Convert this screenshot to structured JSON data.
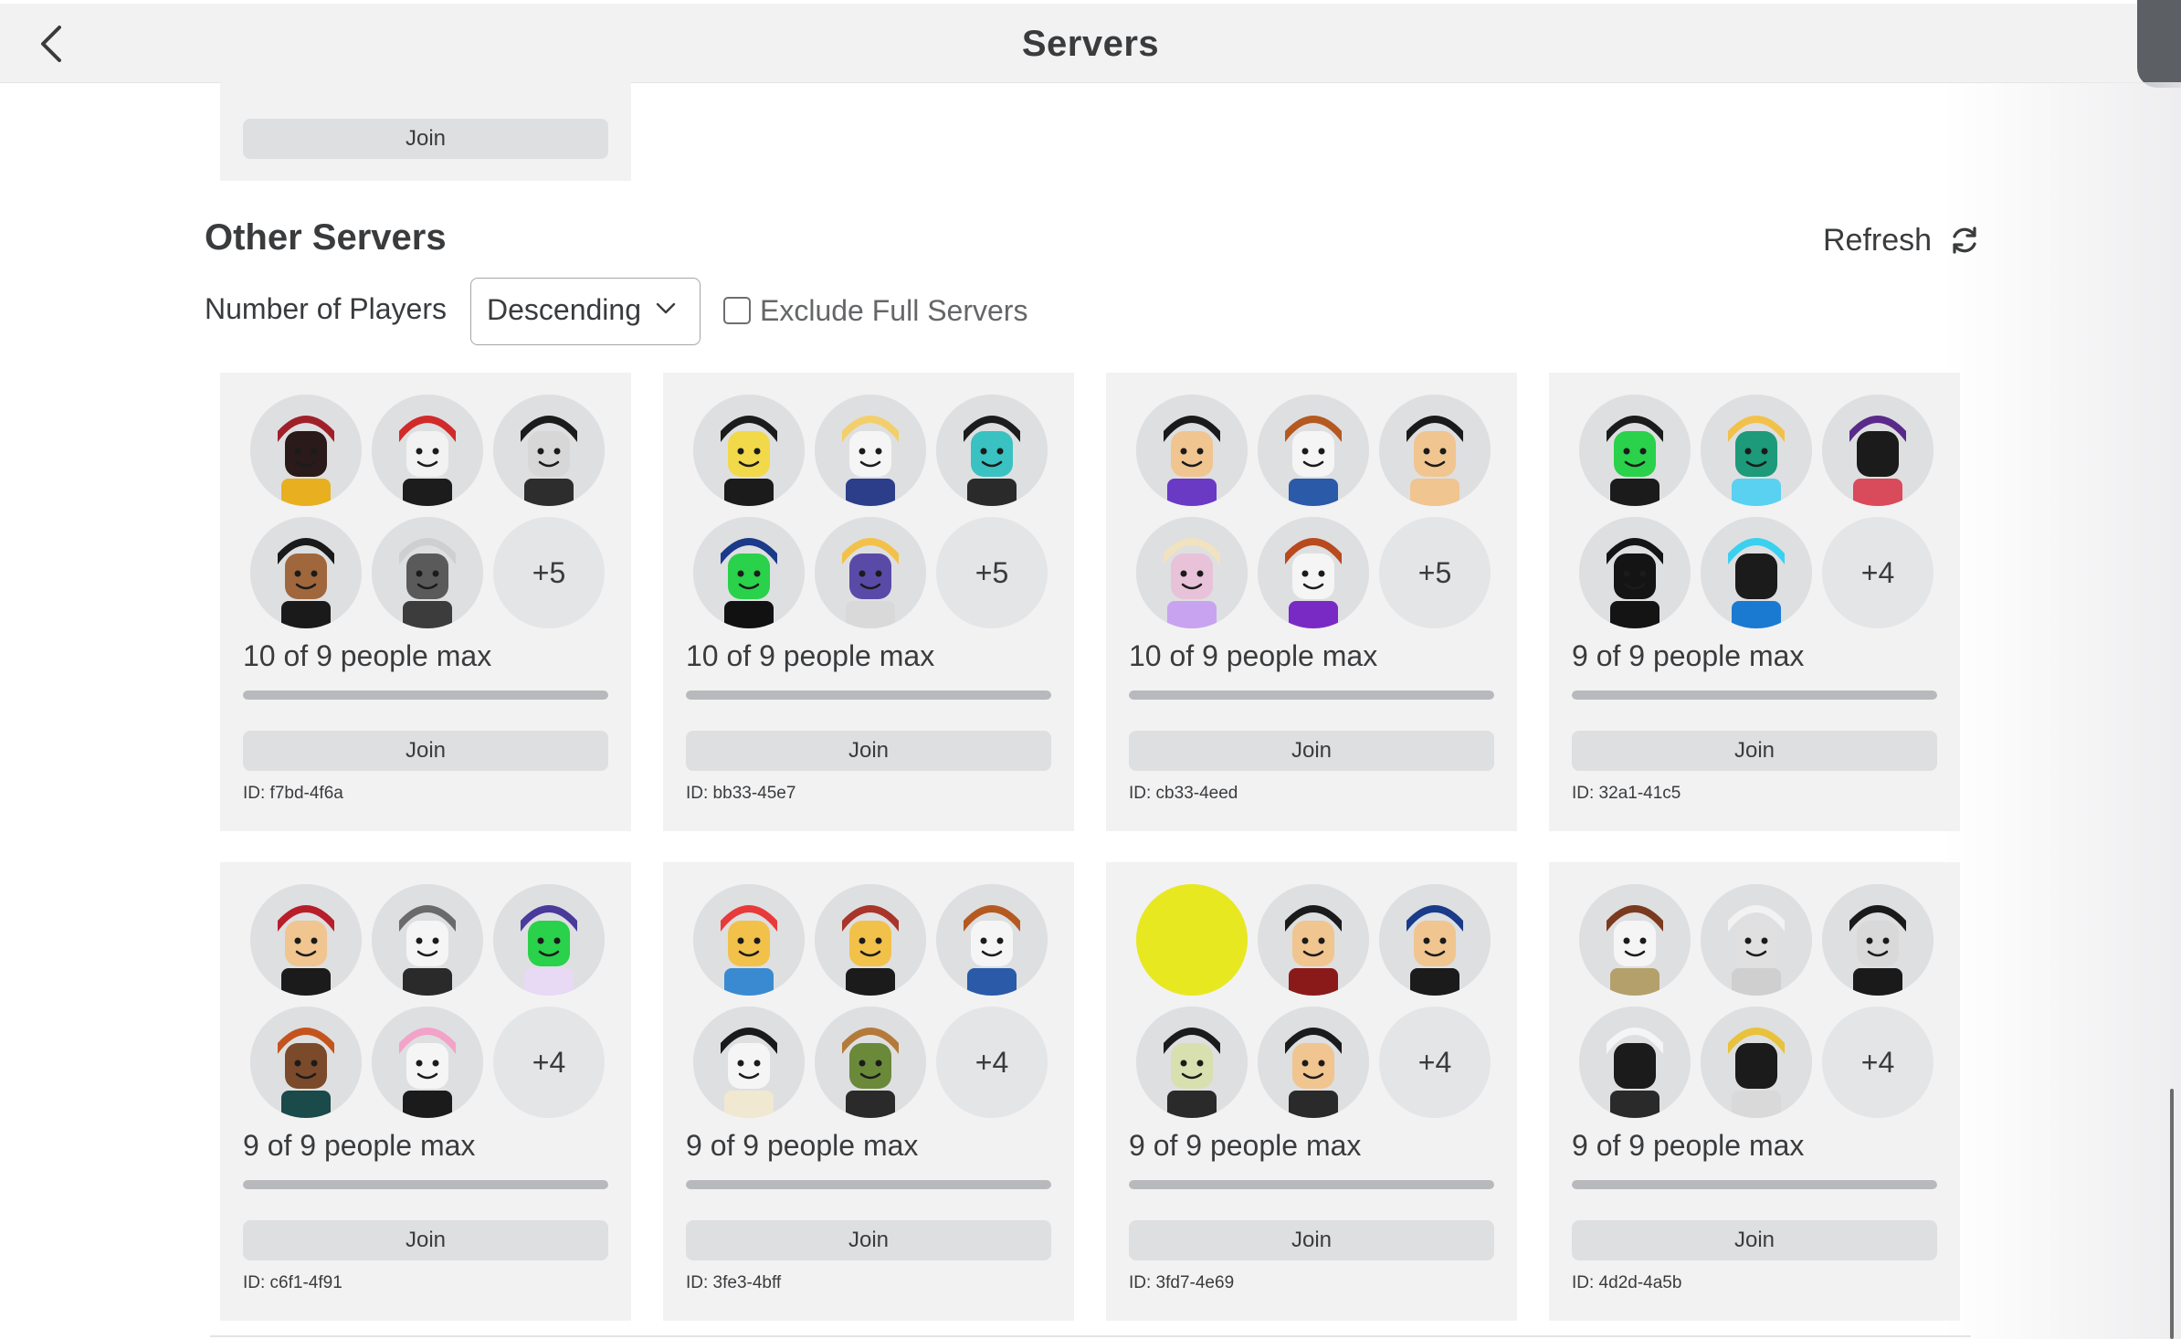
{
  "header": {
    "title": "Servers"
  },
  "previous_section": {
    "join_label": "Join"
  },
  "other_servers": {
    "title": "Other Servers",
    "refresh_label": "Refresh",
    "sort_label": "Number of Players",
    "sort_value": "Descending",
    "exclude_full_label": "Exclude Full Servers",
    "exclude_full_checked": false
  },
  "servers": [
    {
      "players_text": "10 of 9 people max",
      "fill": 1.0,
      "join_label": "Join",
      "id_text": "ID: f7bd-4f6a",
      "more": "+5",
      "avatars": [
        "dark-red-hood",
        "red-cap",
        "black-hair",
        "black-hood",
        "gray-hair"
      ]
    },
    {
      "players_text": "10 of 9 people max",
      "fill": 1.0,
      "join_label": "Join",
      "id_text": "ID: bb33-45e7",
      "more": "+5",
      "avatars": [
        "suit-hat",
        "straw-hat",
        "masked-figure",
        "neon-mask",
        "small-figure"
      ]
    },
    {
      "players_text": "10 of 9 people max",
      "fill": 1.0,
      "join_label": "Join",
      "id_text": "ID: cb33-4eed",
      "more": "+5",
      "avatars": [
        "cap-sunglasses",
        "brown-hair",
        "cap-smile",
        "blonde-girl",
        "red-hair-shades"
      ]
    },
    {
      "players_text": "9 of 9 people max",
      "fill": 1.0,
      "join_label": "Join",
      "id_text": "ID: 32a1-41c5",
      "more": "+4",
      "avatars": [
        "green-glove",
        "crown-blonde",
        "purple-wings",
        "black-silhouette",
        "blue-flame"
      ]
    },
    {
      "players_text": "9 of 9 people max",
      "fill": 1.0,
      "join_label": "Join",
      "id_text": "ID: c6f1-4f91",
      "more": "+4",
      "avatars": [
        "red-hair",
        "white-hair-beanie",
        "witch-hat",
        "orange-hood",
        "pink-hair"
      ]
    },
    {
      "players_text": "9 of 9 people max",
      "fill": 1.0,
      "join_label": "Join",
      "id_text": "ID: 3fe3-4bff",
      "more": "+4",
      "avatars": [
        "colorful-toy",
        "small-knight",
        "brown-hair",
        "white-cap",
        "green-hat"
      ]
    },
    {
      "players_text": "9 of 9 people max",
      "fill": 1.0,
      "join_label": "Join",
      "id_text": "ID: 3fd7-4e69",
      "more": "+4",
      "avatars": [
        "yellow-ball",
        "black-horns",
        "blue-shirt",
        "black-beret",
        "black-spiky-hair"
      ]
    },
    {
      "players_text": "9 of 9 people max",
      "fill": 1.0,
      "join_label": "Join",
      "id_text": "ID: 4d2d-4a5b",
      "more": "+4",
      "avatars": [
        "brown-hat",
        "white-hair",
        "fedora-shades",
        "white-wild-hair",
        "gold-glasses"
      ]
    }
  ]
}
